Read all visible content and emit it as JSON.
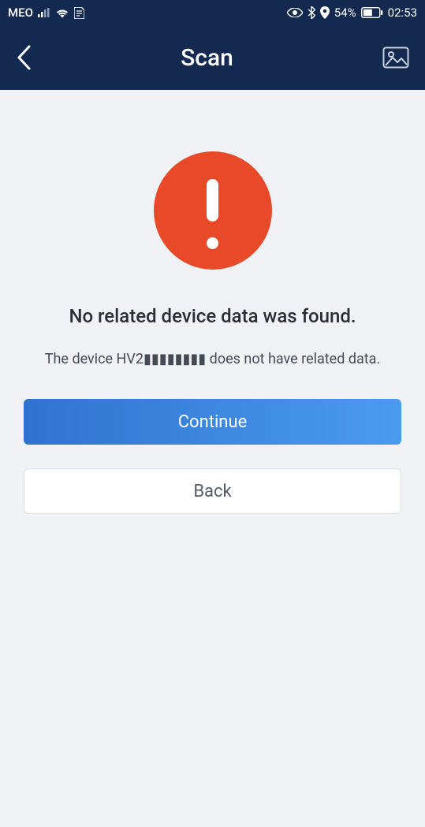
{
  "status_bar": {
    "carrier": "MEO",
    "battery_percent": "54%",
    "time": "02:53"
  },
  "header": {
    "title": "Scan"
  },
  "main": {
    "heading": "No related device data was found.",
    "subtext": "The device HV2▮▮▮▮▮▮▮▮ does not have related data.",
    "continue_label": "Continue",
    "back_label": "Back"
  }
}
